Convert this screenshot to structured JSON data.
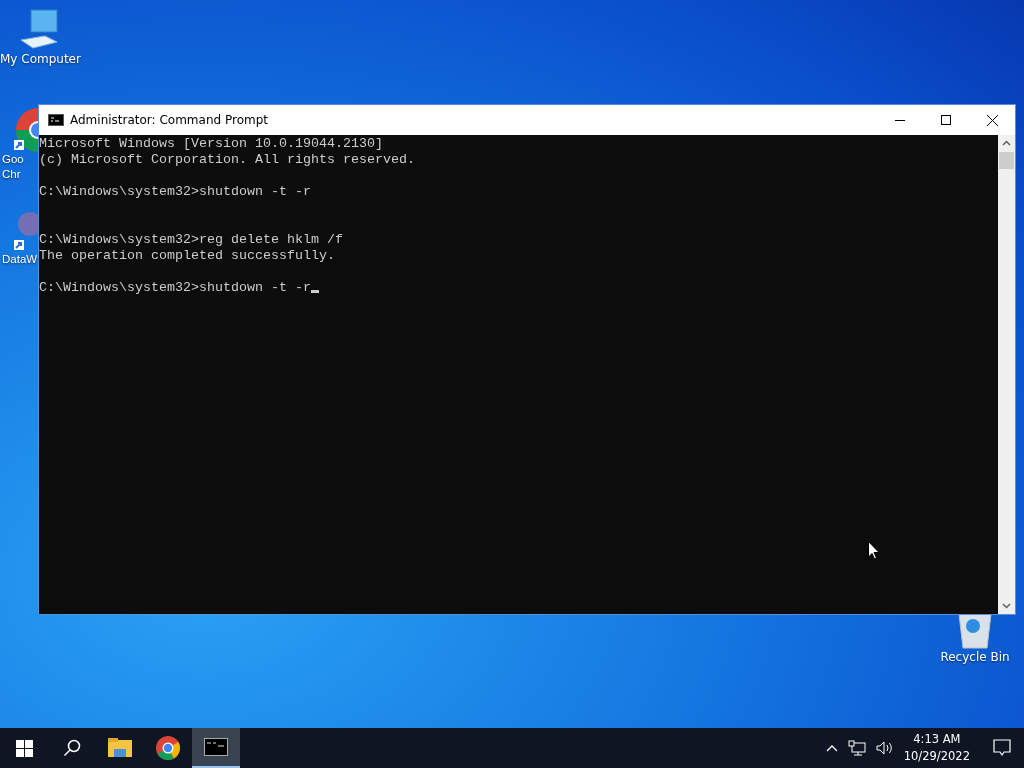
{
  "desktop_icons": [
    {
      "kind": "computer",
      "lines": [
        "My Computer"
      ]
    },
    {
      "kind": "chrome",
      "lines": [
        "Goo",
        "Chr"
      ]
    },
    {
      "kind": "data",
      "lines": [
        "DataW"
      ]
    },
    {
      "kind": "recycle",
      "lines": [
        "Recycle Bin"
      ]
    }
  ],
  "window": {
    "title": "Administrator: Command Prompt",
    "active": true
  },
  "console": {
    "lines": [
      {
        "kind": "text",
        "text": "Microsoft Windows [Version 10.0.19044.2130]"
      },
      {
        "kind": "text",
        "text": "(c) Microsoft Corporation. All rights reserved."
      },
      {
        "kind": "blank"
      },
      {
        "kind": "text",
        "text": "C:\\Windows\\system32>shutdown -t -r"
      },
      {
        "kind": "blank"
      },
      {
        "kind": "blank"
      },
      {
        "kind": "text",
        "text": "C:\\Windows\\system32>reg delete hklm /f"
      },
      {
        "kind": "text",
        "text": "The operation completed successfully."
      },
      {
        "kind": "blank"
      },
      {
        "kind": "text",
        "text": "C:\\Windows\\system32>shutdown -t -r"
      }
    ],
    "cursor_visible": true
  },
  "taskbar": {
    "apps": [
      {
        "kind": "explorer",
        "selected": false
      },
      {
        "kind": "chrome",
        "selected": false
      },
      {
        "kind": "cmd",
        "selected": true
      }
    ],
    "time": "4:13 AM",
    "date": "10/29/2022"
  }
}
